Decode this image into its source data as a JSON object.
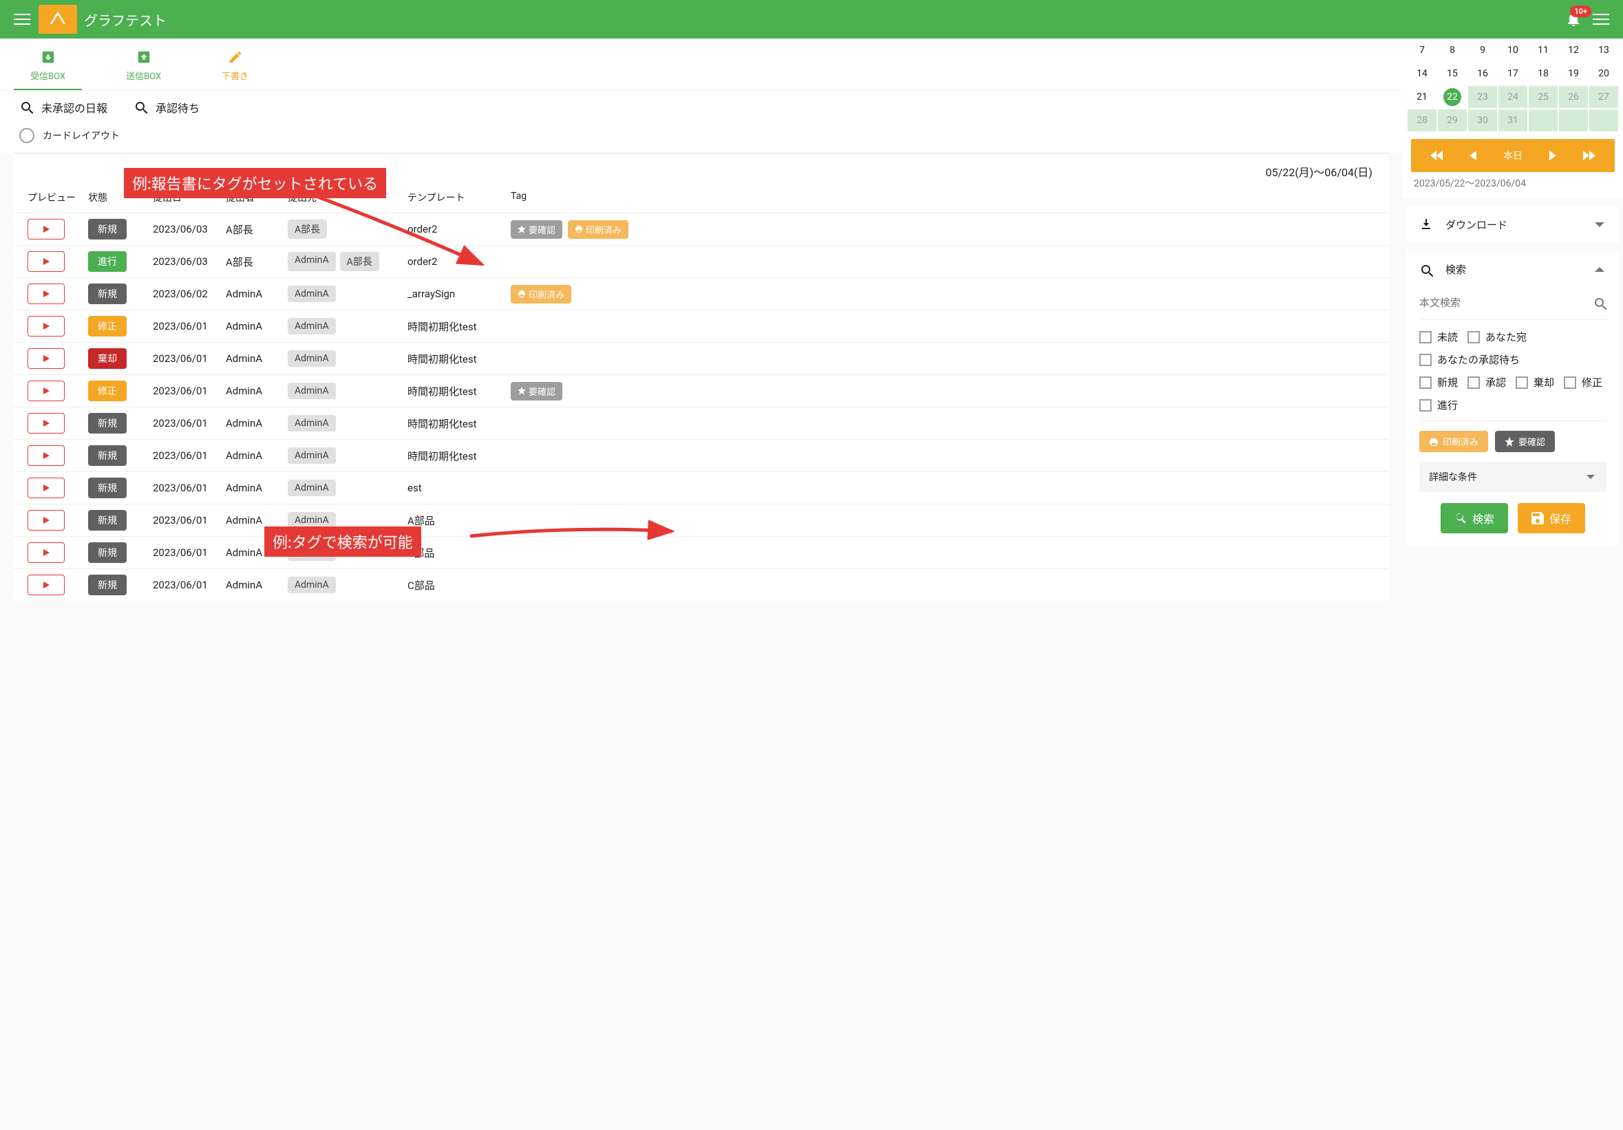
{
  "header": {
    "title": "グラフテスト",
    "badge": "10+"
  },
  "tabs": {
    "inbox": "受信BOX",
    "outbox": "送信BOX",
    "draft": "下書き"
  },
  "quicksearch": {
    "q1": "未承認の日報",
    "q2": "承認待ち"
  },
  "layoutrow": {
    "label": "カードレイアウト"
  },
  "annotation1": "例:報告書にタグがセットされている",
  "annotation2": "例:タグで検索が可能",
  "table": {
    "daterange": "05/22(月)～06/04(日)",
    "cols": {
      "preview": "プレビュー",
      "state": "状態",
      "date": "提出日",
      "submitter": "提出者",
      "dest": "提出先",
      "template": "テンプレート",
      "tag": "Tag"
    },
    "rows": [
      {
        "state": "新規",
        "stClass": "st-new",
        "date": "2023/06/03",
        "sub": "A部長",
        "dest": [
          "A部長"
        ],
        "temp": "order2",
        "tags": [
          {
            "label": "要確認",
            "cls": "gray",
            "icon": "star"
          },
          {
            "label": "印刷済み",
            "cls": "orange",
            "icon": "print"
          }
        ]
      },
      {
        "state": "進行",
        "stClass": "st-prog",
        "date": "2023/06/03",
        "sub": "A部長",
        "dest": [
          "AdminA",
          "A部長"
        ],
        "temp": "order2",
        "tags": []
      },
      {
        "state": "新規",
        "stClass": "st-new",
        "date": "2023/06/02",
        "sub": "AdminA",
        "dest": [
          "AdminA"
        ],
        "temp": "_arraySign",
        "tags": [
          {
            "label": "印刷済み",
            "cls": "orange",
            "icon": "print"
          }
        ]
      },
      {
        "state": "修正",
        "stClass": "st-fix",
        "date": "2023/06/01",
        "sub": "AdminA",
        "dest": [
          "AdminA"
        ],
        "temp": "時間初期化test",
        "tags": []
      },
      {
        "state": "棄却",
        "stClass": "st-rej",
        "date": "2023/06/01",
        "sub": "AdminA",
        "dest": [
          "AdminA"
        ],
        "temp": "時間初期化test",
        "tags": []
      },
      {
        "state": "修正",
        "stClass": "st-fix",
        "date": "2023/06/01",
        "sub": "AdminA",
        "dest": [
          "AdminA"
        ],
        "temp": "時間初期化test",
        "tags": [
          {
            "label": "要確認",
            "cls": "gray",
            "icon": "star"
          }
        ]
      },
      {
        "state": "新規",
        "stClass": "st-new",
        "date": "2023/06/01",
        "sub": "AdminA",
        "dest": [
          "AdminA"
        ],
        "temp": "時間初期化test",
        "tags": []
      },
      {
        "state": "新規",
        "stClass": "st-new",
        "date": "2023/06/01",
        "sub": "AdminA",
        "dest": [
          "AdminA"
        ],
        "temp": "時間初期化test",
        "tags": []
      },
      {
        "state": "新規",
        "stClass": "st-new",
        "date": "2023/06/01",
        "sub": "AdminA",
        "dest": [
          "AdminA"
        ],
        "temp": "est",
        "tags": []
      },
      {
        "state": "新規",
        "stClass": "st-new",
        "date": "2023/06/01",
        "sub": "AdminA",
        "dest": [
          "AdminA"
        ],
        "temp": "A部品",
        "tags": []
      },
      {
        "state": "新規",
        "stClass": "st-new",
        "date": "2023/06/01",
        "sub": "AdminA",
        "dest": [
          "AdminA"
        ],
        "temp": "B部品",
        "tags": []
      },
      {
        "state": "新規",
        "stClass": "st-new",
        "date": "2023/06/01",
        "sub": "AdminA",
        "dest": [
          "AdminA"
        ],
        "temp": "C部品",
        "tags": []
      }
    ]
  },
  "calendar": {
    "weeks": [
      [
        7,
        8,
        9,
        10,
        11,
        12,
        13
      ],
      [
        14,
        15,
        16,
        17,
        18,
        19,
        20
      ],
      [
        21,
        22,
        23,
        24,
        25,
        26,
        27
      ],
      [
        28,
        29,
        30,
        31,
        "",
        "",
        ""
      ]
    ],
    "selected": 22,
    "rangeStart": 23,
    "nav": {
      "today": "本日"
    },
    "rangeLabel": "2023/05/22～2023/06/04"
  },
  "side": {
    "download": "ダウンロード",
    "search": "検索",
    "inputPh": "本文検索",
    "chk": {
      "unread": "未読",
      "toyou": "あなた宛",
      "approval": "あなたの承認待ち",
      "new": "新規",
      "approved": "承認",
      "rejected": "棄却",
      "fix": "修正",
      "progress": "進行"
    },
    "tag1": "印刷済み",
    "tag2": "要確認",
    "detail": "詳細な条件",
    "searchBtn": "検索",
    "saveBtn": "保存"
  }
}
